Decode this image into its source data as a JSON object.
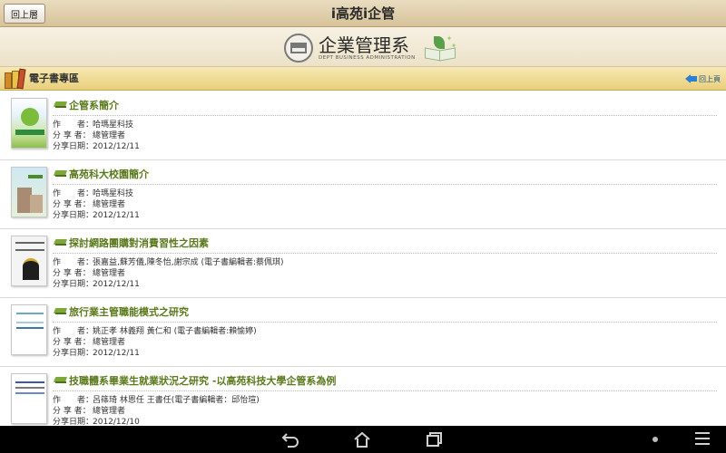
{
  "topbar": {
    "back_label": "回上層",
    "title": "i高苑i企管"
  },
  "banner": {
    "dept_cn": "企業管理系",
    "dept_en": "DEPT BUSINESS ADMINISTRATION"
  },
  "section": {
    "title": "電子書專區",
    "prev_label": "回上頁"
  },
  "books": [
    {
      "title": "企管系簡介",
      "author_label": "作　　者：",
      "author": "哈瑪星科技",
      "sharer_label": "分 享 者：",
      "sharer": "總管理者",
      "date_label": "分享日期：",
      "date": "2012/12/11"
    },
    {
      "title": "高苑科大校園簡介",
      "author_label": "作　　者：",
      "author": "哈瑪星科技",
      "sharer_label": "分 享 者：",
      "sharer": "總管理者",
      "date_label": "分享日期：",
      "date": "2012/12/11"
    },
    {
      "title": "探討網路團購對消費習性之因素",
      "author_label": "作　　者：",
      "author": "張嘉益,蘇芳儀,陳冬怡,謝宗成 (電子書編輯者:蔡佩琪)",
      "sharer_label": "分 享 者：",
      "sharer": "總管理者",
      "date_label": "分享日期：",
      "date": "2012/12/11"
    },
    {
      "title": "旅行業主管職能模式之研究",
      "author_label": "作　　者：",
      "author": "姚正孝 林義翔 黃仁和 (電子書編輯者:賴愉婷)",
      "sharer_label": "分 享 者：",
      "sharer": "總管理者",
      "date_label": "分享日期：",
      "date": "2012/12/11"
    },
    {
      "title": "技職體系畢業生就業狀況之研究 -以高苑科技大學企管系為例",
      "author_label": "作　　者：",
      "author": "呂篠琦 林恩任 王書任(電子書編輯者：邱怡瑄)",
      "sharer_label": "分 享 者：",
      "sharer": "總管理者",
      "date_label": "分享日期：",
      "date": "2012/12/10"
    }
  ],
  "nav": {
    "back_icon": "back-icon",
    "home_icon": "home-icon",
    "recent_icon": "recent-apps-icon",
    "menu_icon": "menu-icon"
  }
}
